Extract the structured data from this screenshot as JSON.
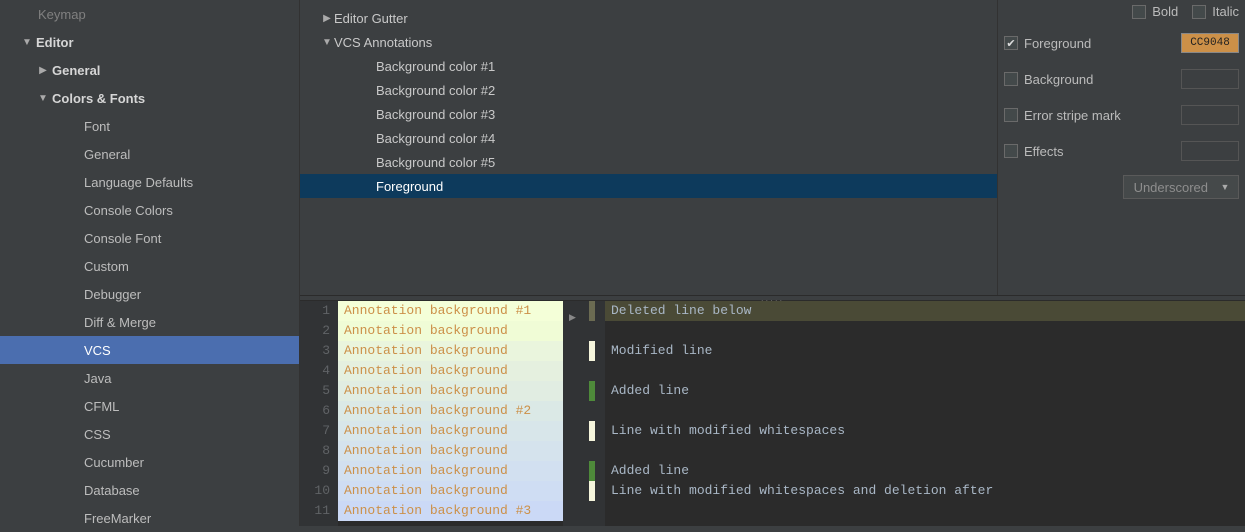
{
  "sidebar": {
    "top_dim": "Keymap",
    "header": "Editor",
    "items": [
      {
        "arrow": "right",
        "label": "General",
        "indent": 1,
        "bold": true
      },
      {
        "arrow": "down",
        "label": "Colors & Fonts",
        "indent": 1,
        "bold": true
      },
      {
        "arrow": "",
        "label": "Font",
        "indent": 3
      },
      {
        "arrow": "",
        "label": "General",
        "indent": 3
      },
      {
        "arrow": "",
        "label": "Language Defaults",
        "indent": 3
      },
      {
        "arrow": "",
        "label": "Console Colors",
        "indent": 3
      },
      {
        "arrow": "",
        "label": "Console Font",
        "indent": 3
      },
      {
        "arrow": "",
        "label": "Custom",
        "indent": 3
      },
      {
        "arrow": "",
        "label": "Debugger",
        "indent": 3
      },
      {
        "arrow": "",
        "label": "Diff & Merge",
        "indent": 3
      },
      {
        "arrow": "",
        "label": "VCS",
        "indent": 3,
        "selected": true
      },
      {
        "arrow": "",
        "label": "Java",
        "indent": 3
      },
      {
        "arrow": "",
        "label": "CFML",
        "indent": 3
      },
      {
        "arrow": "",
        "label": "CSS",
        "indent": 3
      },
      {
        "arrow": "",
        "label": "Cucumber",
        "indent": 3
      },
      {
        "arrow": "",
        "label": "Database",
        "indent": 3
      },
      {
        "arrow": "",
        "label": "FreeMarker",
        "indent": 3
      }
    ]
  },
  "categories": {
    "items": [
      {
        "arrow": "right",
        "label": "Editor Gutter",
        "indent": 0
      },
      {
        "arrow": "down",
        "label": "VCS Annotations",
        "indent": 0
      },
      {
        "arrow": "",
        "label": "Background color #1",
        "indent": 1
      },
      {
        "arrow": "",
        "label": "Background color #2",
        "indent": 1
      },
      {
        "arrow": "",
        "label": "Background color #3",
        "indent": 1
      },
      {
        "arrow": "",
        "label": "Background color #4",
        "indent": 1
      },
      {
        "arrow": "",
        "label": "Background color #5",
        "indent": 1
      },
      {
        "arrow": "",
        "label": "Foreground",
        "indent": 1,
        "selected": true
      }
    ]
  },
  "attrs": {
    "bold_label": "Bold",
    "italic_label": "Italic",
    "foreground": {
      "label": "Foreground",
      "checked": true,
      "color": "CC9048",
      "hex": "#cc9048"
    },
    "background": {
      "label": "Background",
      "checked": false
    },
    "error_stripe": {
      "label": "Error stripe mark",
      "checked": false
    },
    "effects": {
      "label": "Effects",
      "checked": false,
      "combo": "Underscored"
    }
  },
  "preview": {
    "annotations": [
      {
        "text": "Annotation background #1",
        "bg": "#f4ffd8"
      },
      {
        "text": "Annotation background",
        "bg": "#f0fcd6"
      },
      {
        "text": "Annotation background",
        "bg": "#eaf5dd"
      },
      {
        "text": "Annotation background",
        "bg": "#e5f0df"
      },
      {
        "text": "Annotation background",
        "bg": "#e1ede2"
      },
      {
        "text": "Annotation background #2",
        "bg": "#dbe9e6"
      },
      {
        "text": "Annotation background",
        "bg": "#d8e6ea"
      },
      {
        "text": "Annotation background",
        "bg": "#d5e3ed"
      },
      {
        "text": "Annotation background",
        "bg": "#d2e0f0"
      },
      {
        "text": "Annotation background",
        "bg": "#cfddf3"
      },
      {
        "text": "Annotation background #3",
        "bg": "#cbd9f6"
      }
    ],
    "code": [
      {
        "stripe": "#6b6b52",
        "text": "Deleted line below",
        "hl": true,
        "tri": "bottom"
      },
      {
        "stripe": "",
        "text": ""
      },
      {
        "stripe": "#f5f5dc",
        "text": "Modified line"
      },
      {
        "stripe": "",
        "text": ""
      },
      {
        "stripe": "#4e8a3a",
        "text": "Added line"
      },
      {
        "stripe": "",
        "text": ""
      },
      {
        "stripe": "#f5f5dc",
        "text": "Line with modified whitespaces"
      },
      {
        "stripe": "",
        "text": ""
      },
      {
        "stripe": "#4e8a3a",
        "text": "Added line"
      },
      {
        "stripe": "#f5f5dc",
        "text": "Line with modified whitespaces and deletion after"
      },
      {
        "stripe": "",
        "text": ""
      }
    ]
  }
}
